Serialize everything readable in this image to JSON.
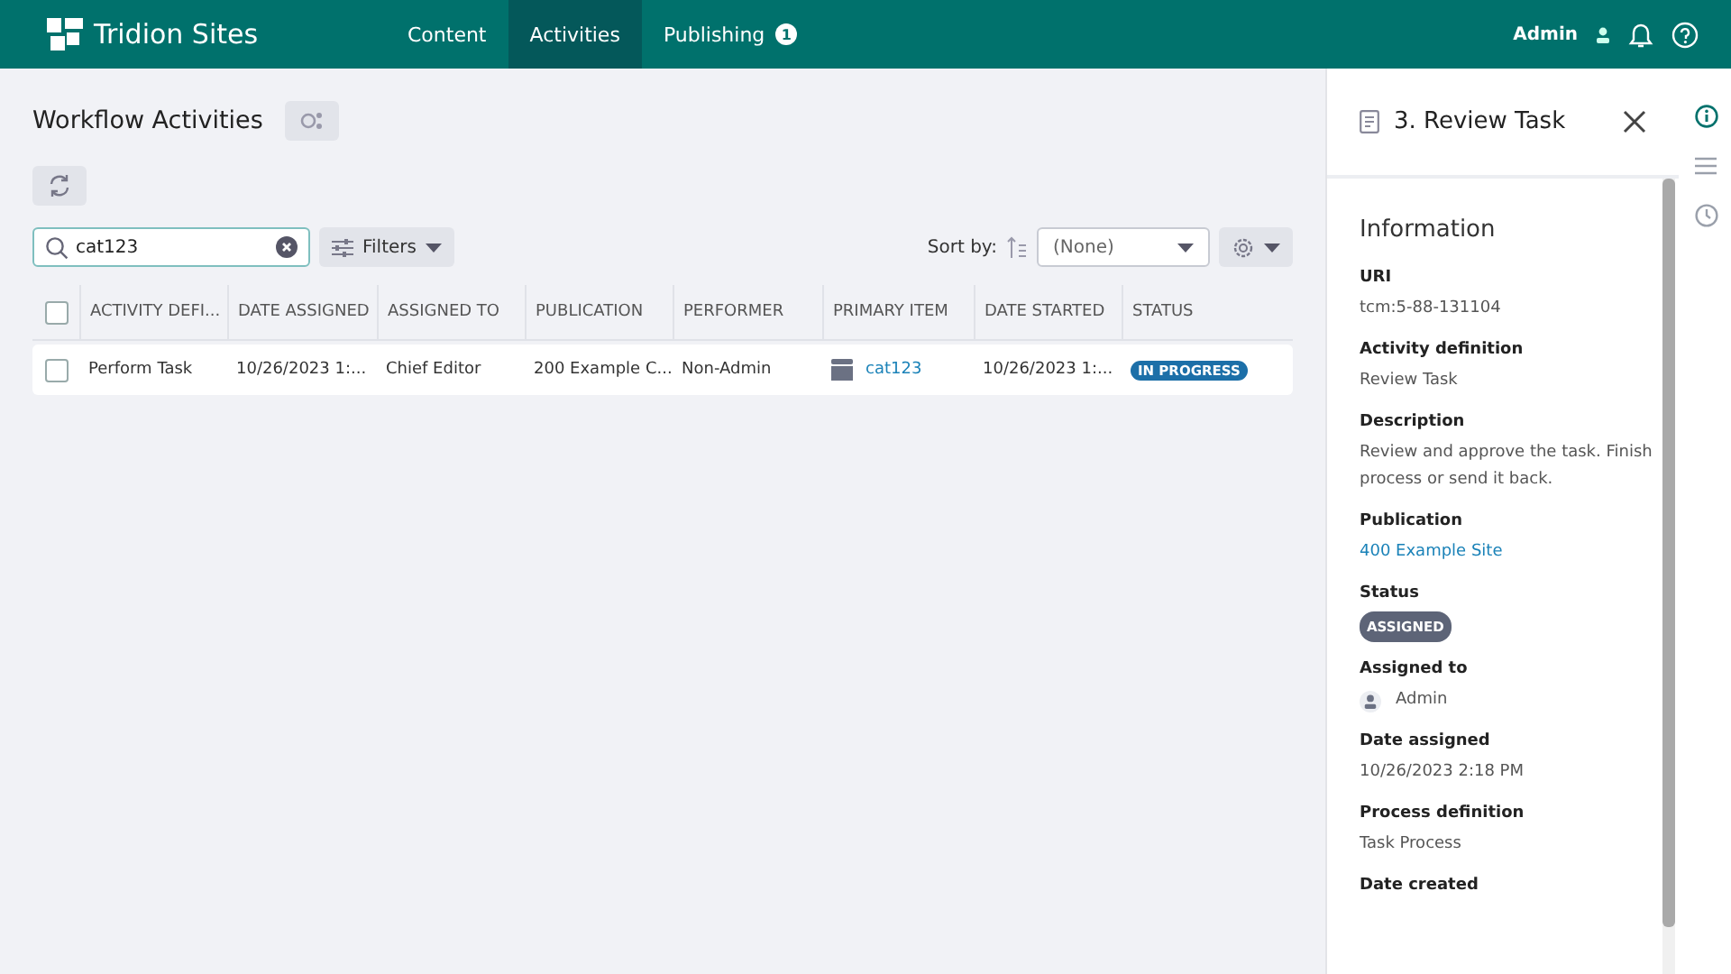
{
  "header": {
    "brand": "Tridion Sites",
    "nav": [
      {
        "label": "Content",
        "selected": false
      },
      {
        "label": "Activities",
        "selected": true
      },
      {
        "label": "Publishing",
        "selected": false,
        "badge": "1"
      }
    ],
    "user": "Admin"
  },
  "page": {
    "title": "Workflow Activities",
    "search": {
      "value": "cat123"
    },
    "filters_label": "Filters",
    "sort_label": "Sort by:",
    "sort_value": "(None)"
  },
  "table": {
    "select_all": {
      "checked": false
    },
    "columns": [
      "ACTIVITY DEFI...",
      "DATE ASSIGNED",
      "ASSIGNED TO",
      "PUBLICATION",
      "PERFORMER",
      "PRIMARY ITEM",
      "DATE STARTED",
      "STATUS"
    ],
    "rows": [
      {
        "checked": false,
        "cells": [
          {
            "kind": "text",
            "text": "Perform Task"
          },
          {
            "kind": "text",
            "text": "10/26/2023 1:..."
          },
          {
            "kind": "text",
            "text": "Chief Editor"
          },
          {
            "kind": "text",
            "text": "200 Example C..."
          },
          {
            "kind": "text",
            "text": "Non-Admin"
          },
          {
            "kind": "item",
            "text": "cat123"
          },
          {
            "kind": "text",
            "text": "10/26/2023 1:..."
          },
          {
            "kind": "badge",
            "text": "IN PROGRESS"
          }
        ]
      }
    ]
  },
  "panel": {
    "title": "3. Review Task",
    "section": "Information",
    "fields": [
      {
        "label": "URI",
        "kind": "text",
        "value": "tcm:5-88-131104"
      },
      {
        "label": "Activity definition",
        "kind": "text",
        "value": "Review Task"
      },
      {
        "label": "Description",
        "kind": "text",
        "value": "Review and approve the task. Finish process or send it back."
      },
      {
        "label": "Publication",
        "kind": "link",
        "value": "400 Example Site"
      },
      {
        "label": "Status",
        "kind": "badge",
        "value": "ASSIGNED"
      },
      {
        "label": "Assigned to",
        "kind": "user",
        "value": "Admin"
      },
      {
        "label": "Date assigned",
        "kind": "text",
        "value": "10/26/2023 2:18 PM"
      },
      {
        "label": "Process definition",
        "kind": "text",
        "value": "Task Process"
      },
      {
        "label": "Date created",
        "kind": "label"
      }
    ]
  },
  "rail": [
    {
      "kind": "info",
      "selected": true
    },
    {
      "kind": "list",
      "selected": false
    },
    {
      "kind": "history",
      "selected": false
    }
  ]
}
